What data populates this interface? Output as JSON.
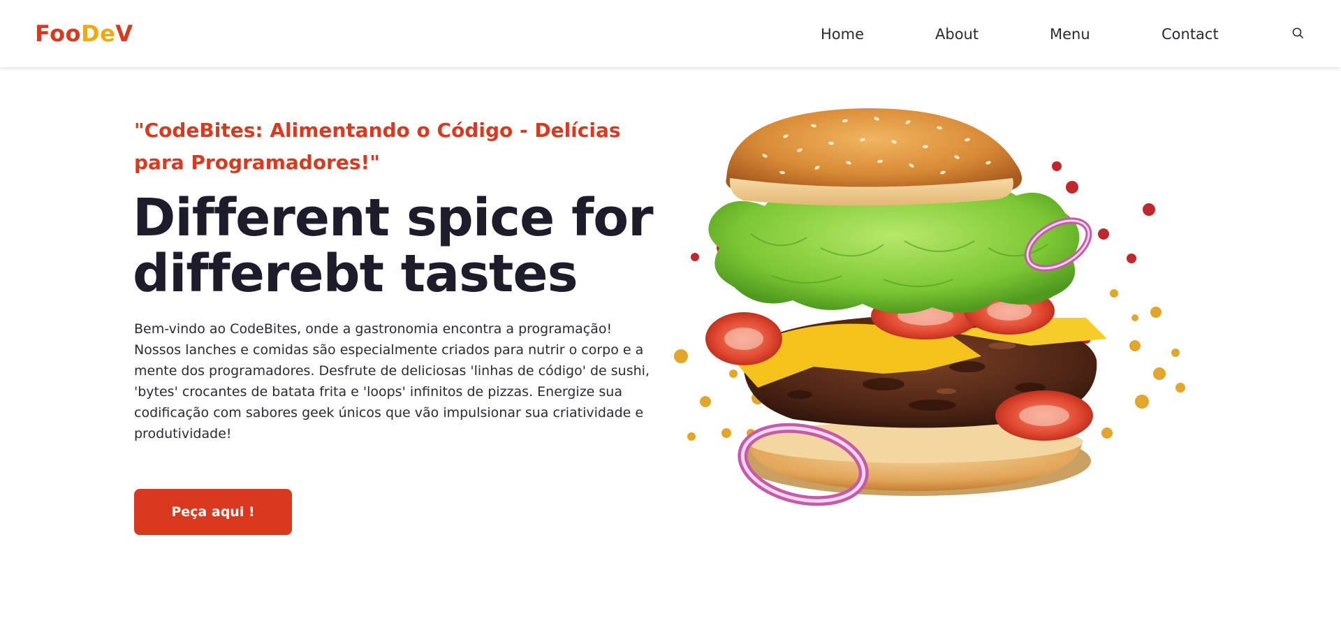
{
  "navbar": {
    "logo": {
      "part1": "Foo",
      "part2": "De",
      "part3": "V"
    },
    "links": [
      {
        "label": "Home"
      },
      {
        "label": "About"
      },
      {
        "label": "Menu"
      },
      {
        "label": "Contact"
      }
    ],
    "search_icon": "search-icon"
  },
  "hero": {
    "tagline": "\"CodeBites: Alimentando o Código - Delícias para Programadores!\"",
    "headline": "Different spice for differebt tastes",
    "description": "Bem-vindo ao CodeBites, onde a gastronomia encontra a programação! Nossos lanches e comidas são especialmente criados para nutrir o corpo e a mente dos programadores. Desfrute de deliciosas 'linhas de código' de sushi, 'bytes' crocantes de batata frita e 'loops' infinitos de pizzas. Energize sua codificação com sabores geek únicos que vão impulsionar sua criatividade e produtividade!",
    "cta_label": "Peça aqui !",
    "image_icon": "burger-image"
  },
  "colors": {
    "accent": "#d9391f",
    "logo_yellow": "#f0a90f",
    "heading": "#1c1c2b",
    "text": "#2a2a33",
    "background": "#ffffff"
  }
}
